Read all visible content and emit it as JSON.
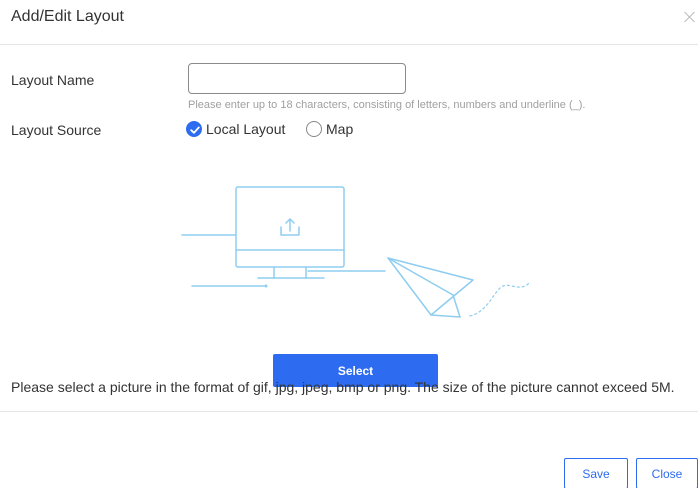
{
  "dialog": {
    "title": "Add/Edit Layout",
    "close_icon": "close-icon"
  },
  "form": {
    "layout_name": {
      "label": "Layout Name",
      "value": "",
      "hint": "Please enter up to 18 characters, consisting of letters, numbers and underline (_)."
    },
    "layout_source": {
      "label": "Layout Source",
      "options": [
        {
          "label": "Local Layout",
          "checked": true
        },
        {
          "label": "Map",
          "checked": false
        }
      ]
    }
  },
  "upload": {
    "illustration_icon": "upload-monitor-illustration",
    "select_label": "Select",
    "format_note": "Please select a picture in the format of gif, jpg, jpeg, bmp or png. The size of the picture cannot exceed 5M."
  },
  "footer": {
    "save_label": "Save",
    "close_label": "Close"
  },
  "colors": {
    "accent": "#2d6cf0",
    "illustration": "#8ecdf0",
    "hint": "#a0a0a0",
    "divider": "#e6e6e6"
  }
}
